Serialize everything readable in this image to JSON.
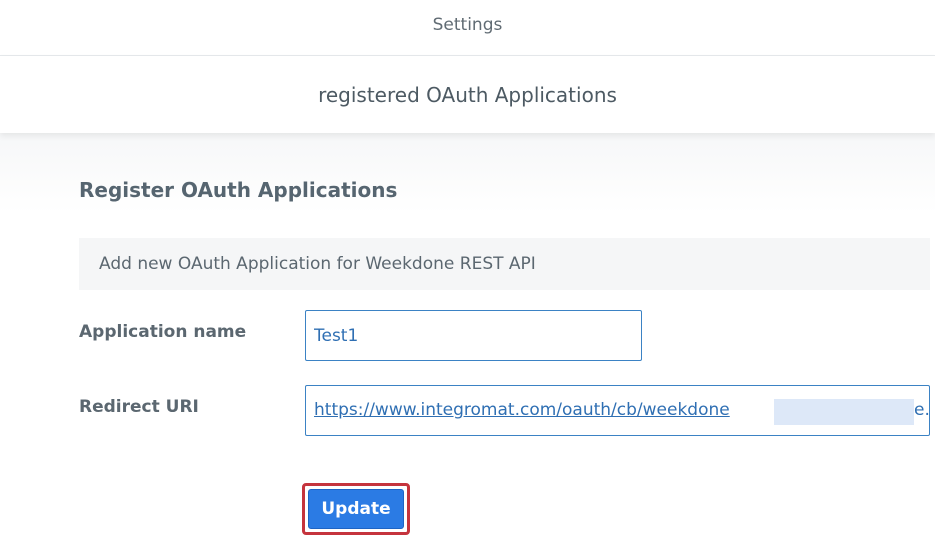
{
  "header": {
    "title": "Settings"
  },
  "subheader": {
    "title": "registered OAuth Applications"
  },
  "form": {
    "heading": "Register OAuth Applications",
    "info_text": "Add new OAuth Application for Weekdone REST API",
    "app_name_label": "Application name",
    "app_name_value": "Test1",
    "redirect_uri_label": "Redirect URI",
    "redirect_uri_value": "https://www.integromat.com/oauth/cb/weekdone",
    "redirect_uri_tail": "e.c",
    "submit_label": "Update"
  },
  "colors": {
    "accent": "#2b7be4",
    "highlight_border": "#c5343d",
    "input_border": "#3b82c4",
    "link": "#2f6fb3"
  }
}
